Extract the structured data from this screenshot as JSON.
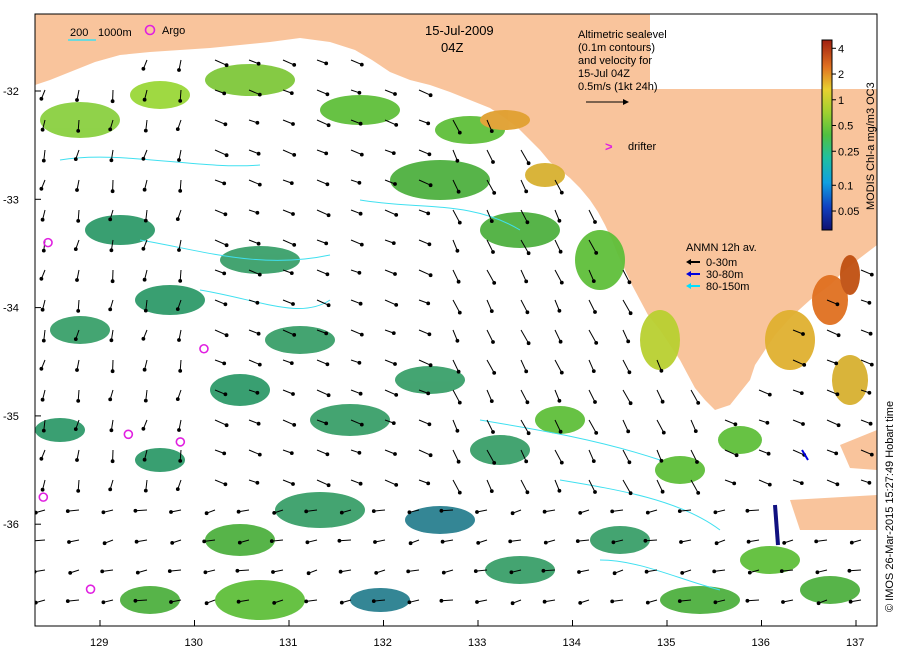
{
  "header": {
    "date": "15-Jul-2009",
    "time": "04Z"
  },
  "scale": {
    "contour_200": "200",
    "contour_1000": "1000m"
  },
  "argo_label": "Argo",
  "altimetry_note": {
    "line1": "Altimetric sealevel",
    "line2": "(0.1m contours)",
    "line3": "and velocity for",
    "line4": "15-Jul 04Z",
    "line5": "0.5m/s (1kt 24h)"
  },
  "drifter": {
    "symbol": ">",
    "label": "drifter"
  },
  "anmn": {
    "title": "ANMN 12h av.",
    "items": [
      {
        "label": "0-30m",
        "color": "#000000"
      },
      {
        "label": "30-80m",
        "color": "#0000dd"
      },
      {
        "label": "80-150m",
        "color": "#00e0ff"
      }
    ]
  },
  "colorbar": {
    "title": "MODIS Chl-a mg/m3 OC3",
    "ticks": [
      "4",
      "2",
      "1",
      "0.5",
      "0.25",
      "0.1",
      "0.05"
    ]
  },
  "credit": "© IMOS 26-Mar-2015 15:27:49 Hobart time",
  "axes": {
    "lat_ticks": [
      "-32",
      "-33",
      "-34",
      "-35",
      "-36"
    ],
    "lon_ticks": [
      "129",
      "130",
      "131",
      "132",
      "133",
      "134",
      "135",
      "136",
      "137"
    ]
  },
  "colors": {
    "land": "#f9c49c",
    "argo": "#e020e0",
    "drifter": "#e020e0",
    "contour": "#40e0f0",
    "chl_low": "#2f9a6a",
    "chl_mid": "#6fcf3a",
    "chl_high": "#e07020"
  },
  "argo_floats": [
    {
      "lon": 128.45,
      "lat": -33.4
    },
    {
      "lon": 130.1,
      "lat": -34.38
    },
    {
      "lon": 129.3,
      "lat": -35.17
    },
    {
      "lon": 129.85,
      "lat": -35.24
    },
    {
      "lon": 128.4,
      "lat": -35.75
    },
    {
      "lon": 128.9,
      "lat": -36.6
    }
  ]
}
